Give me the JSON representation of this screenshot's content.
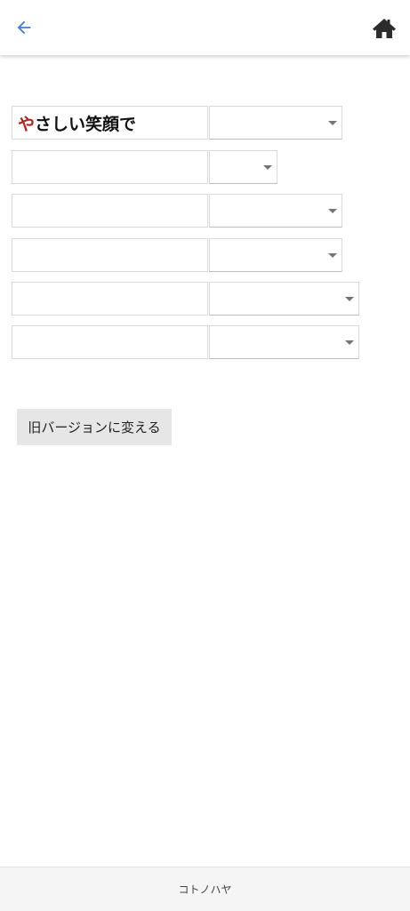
{
  "header": {
    "back_icon": "arrow-left-icon",
    "home_icon": "home-icon",
    "accent_color": "#3f7fd8"
  },
  "rows": [
    {
      "text_first": "や",
      "text_rest": "さしい笑顔で",
      "selected": ""
    },
    {
      "text_first": "",
      "text_rest": "",
      "selected": ""
    },
    {
      "text_first": "",
      "text_rest": "",
      "selected": ""
    },
    {
      "text_first": "",
      "text_rest": "",
      "selected": ""
    },
    {
      "text_first": "",
      "text_rest": "",
      "selected": ""
    },
    {
      "text_first": "",
      "text_rest": "",
      "selected": ""
    }
  ],
  "actions": {
    "old_version_label": "旧バージョンに変える"
  },
  "footer": {
    "brand": "コトノハヤ"
  }
}
